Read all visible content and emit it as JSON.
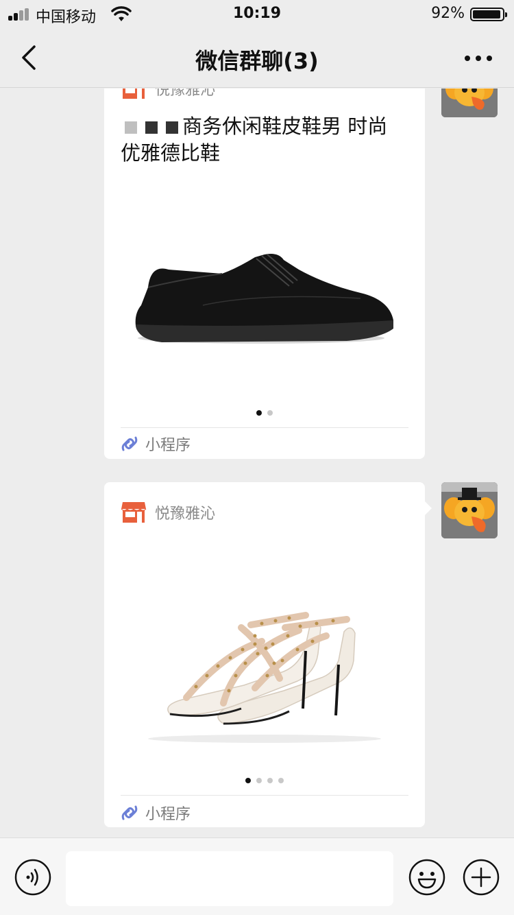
{
  "status_bar": {
    "carrier": "中国移动",
    "time": "10:19",
    "battery": "92%",
    "battery_level": 0.92
  },
  "nav": {
    "title": "微信群聊(3)"
  },
  "messages": [
    {
      "shop_name": "悦豫雅沁",
      "title_suffix": "商务休闲鞋皮鞋男 时尚优雅德比鞋",
      "dots": 2,
      "active_dot": 0,
      "mini_program_label": "小程序"
    },
    {
      "shop_name": "悦豫雅沁",
      "dots": 4,
      "active_dot": 0,
      "mini_program_label": "小程序"
    }
  ],
  "icons": {
    "back": "chevron-left-icon",
    "more": "more-dots-icon",
    "shop": "shop-icon",
    "mini_program": "mini-program-icon",
    "voice": "voice-icon",
    "emoji": "emoji-icon",
    "plus": "plus-icon"
  },
  "colors": {
    "background": "#ededed",
    "shop_icon": "#e8603c",
    "mini_program_icon": "#6b7fd6"
  },
  "input": {
    "value": "",
    "placeholder": ""
  }
}
